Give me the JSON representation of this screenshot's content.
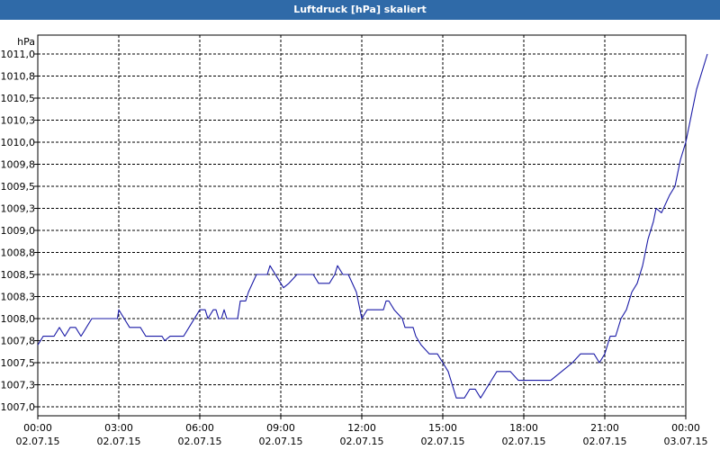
{
  "window": {
    "title": "Luftdruck [hPa] skaliert"
  },
  "chart_data": {
    "type": "line",
    "title": "Luftdruck [hPa] skaliert",
    "ylabel": "hPa",
    "xlabel": "",
    "ylim": [
      1006.9,
      1011.1
    ],
    "xlim_hours": [
      0,
      24
    ],
    "grid": true,
    "y_ticks": [
      {
        "value": 1007.0,
        "label": "1007,0"
      },
      {
        "value": 1007.25,
        "label": "1007,3"
      },
      {
        "value": 1007.5,
        "label": "1007,5"
      },
      {
        "value": 1007.75,
        "label": "1007,8"
      },
      {
        "value": 1008.0,
        "label": "1008,0"
      },
      {
        "value": 1008.25,
        "label": "1008,3"
      },
      {
        "value": 1008.5,
        "label": "1008,5"
      },
      {
        "value": 1008.75,
        "label": "1008,8"
      },
      {
        "value": 1009.0,
        "label": "1009,0"
      },
      {
        "value": 1009.25,
        "label": "1009,3"
      },
      {
        "value": 1009.5,
        "label": "1009,5"
      },
      {
        "value": 1009.75,
        "label": "1009,8"
      },
      {
        "value": 1010.0,
        "label": "1010,0"
      },
      {
        "value": 1010.25,
        "label": "1010,3"
      },
      {
        "value": 1010.5,
        "label": "1010,5"
      },
      {
        "value": 1010.75,
        "label": "1010,8"
      },
      {
        "value": 1011.0,
        "label": "1011,0"
      }
    ],
    "x_ticks": [
      {
        "hour": 0,
        "time": "00:00",
        "date": "02.07.15"
      },
      {
        "hour": 3,
        "time": "03:00",
        "date": "02.07.15"
      },
      {
        "hour": 6,
        "time": "06:00",
        "date": "02.07.15"
      },
      {
        "hour": 9,
        "time": "09:00",
        "date": "02.07.15"
      },
      {
        "hour": 12,
        "time": "12:00",
        "date": "02.07.15"
      },
      {
        "hour": 15,
        "time": "15:00",
        "date": "02.07.15"
      },
      {
        "hour": 18,
        "time": "18:00",
        "date": "02.07.15"
      },
      {
        "hour": 21,
        "time": "21:00",
        "date": "02.07.15"
      },
      {
        "hour": 24,
        "time": "00:00",
        "date": "03.07.15"
      }
    ],
    "series": [
      {
        "color": "#1a1aa6",
        "points": [
          [
            0.0,
            1007.7
          ],
          [
            0.2,
            1007.8
          ],
          [
            0.6,
            1007.8
          ],
          [
            0.8,
            1007.9
          ],
          [
            1.0,
            1007.8
          ],
          [
            1.2,
            1007.9
          ],
          [
            1.4,
            1007.9
          ],
          [
            1.6,
            1007.8
          ],
          [
            1.8,
            1007.9
          ],
          [
            2.0,
            1008.0
          ],
          [
            2.4,
            1008.0
          ],
          [
            2.8,
            1008.0
          ],
          [
            2.95,
            1008.0
          ],
          [
            3.0,
            1008.1
          ],
          [
            3.2,
            1008.0
          ],
          [
            3.4,
            1007.9
          ],
          [
            3.8,
            1007.9
          ],
          [
            4.0,
            1007.8
          ],
          [
            4.6,
            1007.8
          ],
          [
            4.7,
            1007.75
          ],
          [
            4.9,
            1007.8
          ],
          [
            5.4,
            1007.8
          ],
          [
            5.6,
            1007.9
          ],
          [
            6.0,
            1008.1
          ],
          [
            6.2,
            1008.1
          ],
          [
            6.3,
            1008.0
          ],
          [
            6.5,
            1008.1
          ],
          [
            6.6,
            1008.1
          ],
          [
            6.7,
            1008.0
          ],
          [
            6.8,
            1008.0
          ],
          [
            6.9,
            1008.1
          ],
          [
            7.0,
            1008.0
          ],
          [
            7.4,
            1008.0
          ],
          [
            7.5,
            1008.2
          ],
          [
            7.7,
            1008.2
          ],
          [
            7.8,
            1008.3
          ],
          [
            8.1,
            1008.5
          ],
          [
            8.5,
            1008.5
          ],
          [
            8.6,
            1008.6
          ],
          [
            9.0,
            1008.4
          ],
          [
            9.1,
            1008.35
          ],
          [
            9.3,
            1008.4
          ],
          [
            9.6,
            1008.5
          ],
          [
            10.0,
            1008.5
          ],
          [
            10.2,
            1008.5
          ],
          [
            10.4,
            1008.4
          ],
          [
            10.8,
            1008.4
          ],
          [
            11.0,
            1008.5
          ],
          [
            11.1,
            1008.6
          ],
          [
            11.3,
            1008.5
          ],
          [
            11.5,
            1008.5
          ],
          [
            11.8,
            1008.3
          ],
          [
            12.0,
            1008.0
          ],
          [
            12.2,
            1008.1
          ],
          [
            12.8,
            1008.1
          ],
          [
            12.9,
            1008.2
          ],
          [
            13.0,
            1008.2
          ],
          [
            13.2,
            1008.1
          ],
          [
            13.5,
            1008.0
          ],
          [
            13.6,
            1007.9
          ],
          [
            13.9,
            1007.9
          ],
          [
            14.0,
            1007.8
          ],
          [
            14.2,
            1007.7
          ],
          [
            14.5,
            1007.6
          ],
          [
            14.8,
            1007.6
          ],
          [
            15.0,
            1007.5
          ],
          [
            15.2,
            1007.4
          ],
          [
            15.3,
            1007.3
          ],
          [
            15.5,
            1007.1
          ],
          [
            15.8,
            1007.1
          ],
          [
            16.0,
            1007.2
          ],
          [
            16.2,
            1007.2
          ],
          [
            16.4,
            1007.1
          ],
          [
            16.6,
            1007.2
          ],
          [
            16.8,
            1007.3
          ],
          [
            17.0,
            1007.4
          ],
          [
            17.5,
            1007.4
          ],
          [
            17.8,
            1007.3
          ],
          [
            18.0,
            1007.3
          ],
          [
            18.8,
            1007.3
          ],
          [
            19.0,
            1007.3
          ],
          [
            19.4,
            1007.4
          ],
          [
            19.8,
            1007.5
          ],
          [
            20.1,
            1007.6
          ],
          [
            20.6,
            1007.6
          ],
          [
            20.8,
            1007.5
          ],
          [
            21.0,
            1007.6
          ],
          [
            21.2,
            1007.8
          ],
          [
            21.4,
            1007.8
          ],
          [
            21.6,
            1008.0
          ],
          [
            21.8,
            1008.1
          ],
          [
            22.0,
            1008.3
          ],
          [
            22.2,
            1008.4
          ],
          [
            22.4,
            1008.6
          ],
          [
            22.6,
            1008.9
          ],
          [
            22.8,
            1009.1
          ],
          [
            22.9,
            1009.25
          ],
          [
            23.1,
            1009.2
          ],
          [
            23.4,
            1009.4
          ],
          [
            23.6,
            1009.5
          ],
          [
            23.8,
            1009.8
          ],
          [
            24.0,
            1010.0
          ],
          [
            24.2,
            1010.3
          ],
          [
            24.4,
            1010.6
          ],
          [
            24.6,
            1010.8
          ],
          [
            24.8,
            1011.0
          ]
        ]
      }
    ]
  }
}
